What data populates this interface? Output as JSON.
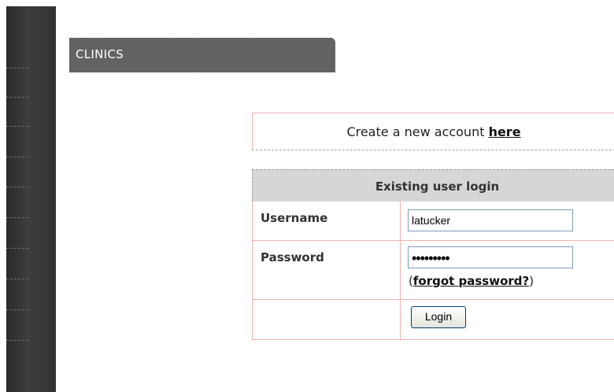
{
  "header": {
    "title": "CLINICS"
  },
  "create_account": {
    "text": "Create a new account ",
    "link": "here"
  },
  "login": {
    "heading": "Existing user login",
    "username_label": "Username",
    "username_value": "latucker",
    "password_label": "Password",
    "password_mask": "•••••••••",
    "forgot_open": "(",
    "forgot_link": "forgot password?",
    "forgot_close": ")",
    "button_label": "Login"
  }
}
